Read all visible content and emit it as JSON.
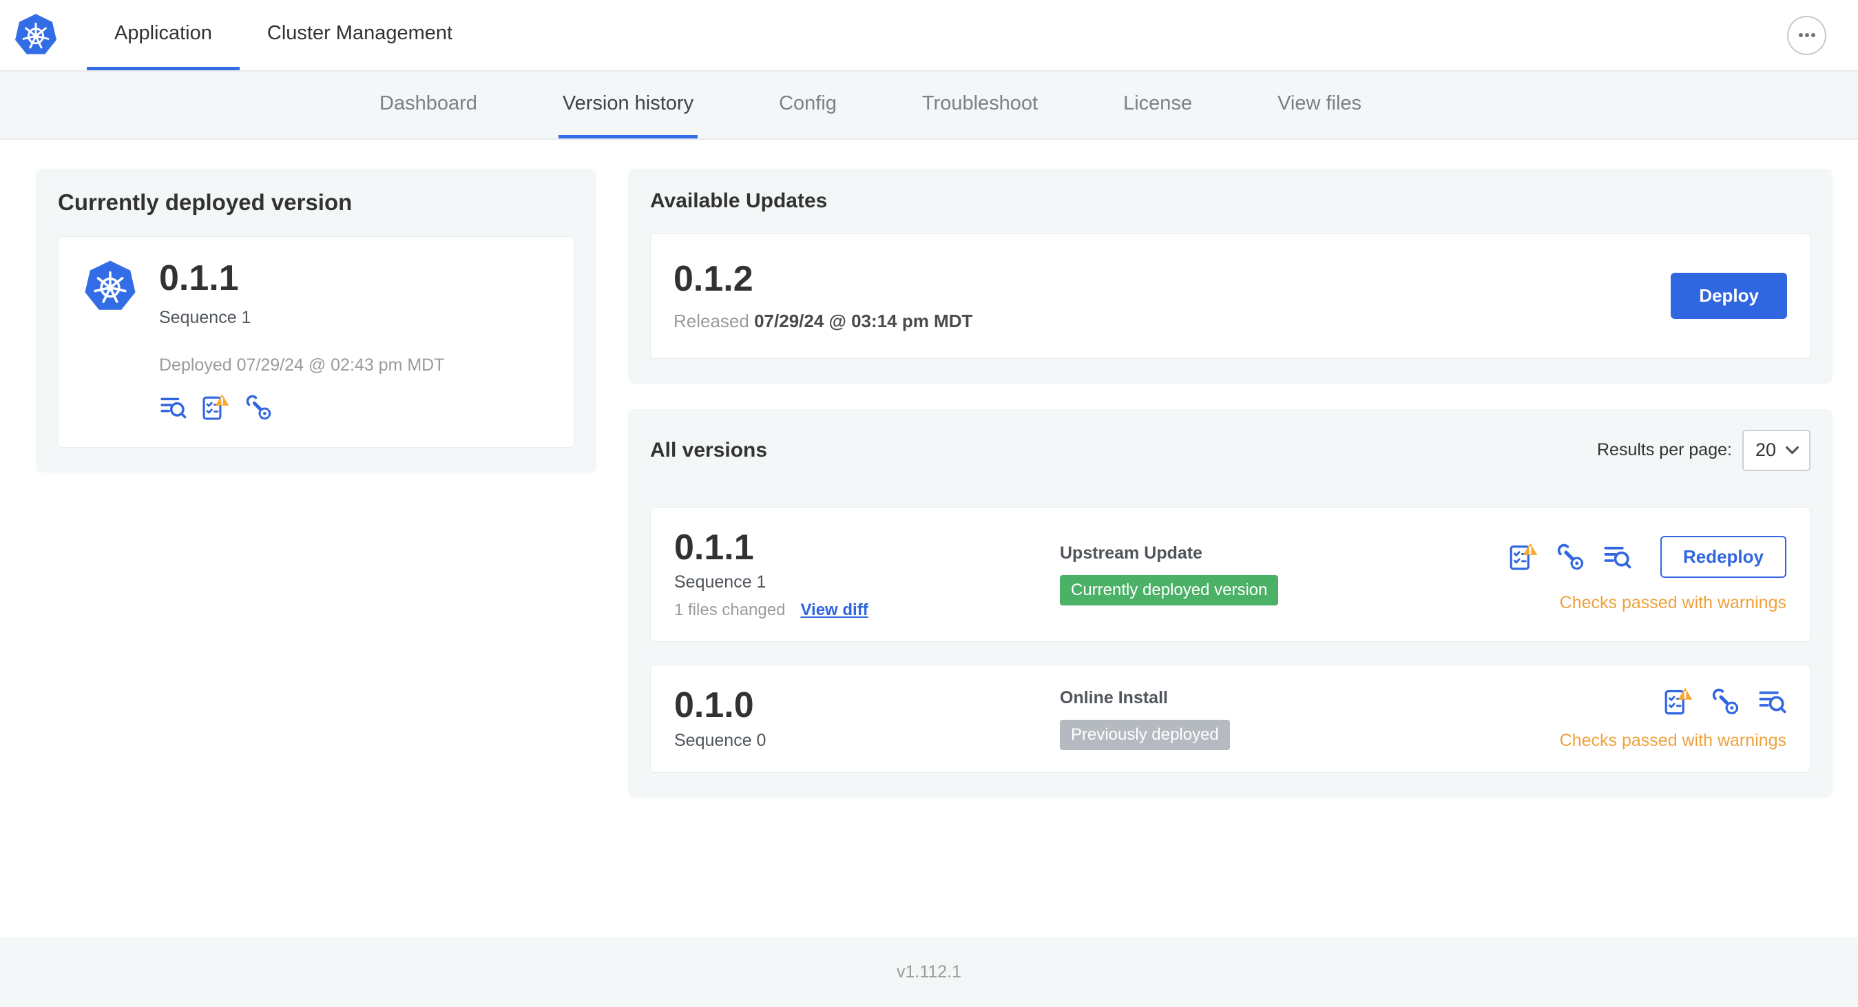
{
  "topnav": {
    "tabs": [
      "Application",
      "Cluster Management"
    ],
    "active": "Application",
    "more_icon": "ellipsis-icon"
  },
  "subnav": {
    "tabs": [
      "Dashboard",
      "Version history",
      "Config",
      "Troubleshoot",
      "License",
      "View files"
    ],
    "active": "Version history"
  },
  "deployed": {
    "title": "Currently deployed version",
    "version": "0.1.1",
    "sequence": "Sequence 1",
    "deployed_at": "Deployed 07/29/24 @ 02:43 pm MDT",
    "icons": [
      "deploy-logs-icon",
      "preflight-checks-warning-icon",
      "edit-config-icon"
    ]
  },
  "available_updates": {
    "title": "Available Updates",
    "version": "0.1.2",
    "released_label": "Released",
    "released_date": "07/29/24 @ 03:14 pm MDT",
    "deploy_button": "Deploy"
  },
  "all_versions": {
    "title": "All versions",
    "results_per_page_label": "Results per page:",
    "results_per_page": "20",
    "rows": [
      {
        "version": "0.1.1",
        "sequence": "Sequence 1",
        "files_changed": "1 files changed",
        "view_diff_link": "View diff",
        "source": "Upstream Update",
        "badge": "Currently deployed version",
        "badge_color": "#4bb166",
        "icons": [
          "preflight-checks-warning-icon",
          "edit-config-icon",
          "deploy-logs-icon"
        ],
        "action_button": "Redeploy",
        "status": "Checks passed with warnings",
        "status_color": "#efa13b"
      },
      {
        "version": "0.1.0",
        "sequence": "Sequence 0",
        "source": "Online Install",
        "badge": "Previously deployed",
        "badge_color": "#b5bac1",
        "icons": [
          "preflight-checks-warning-icon",
          "edit-config-icon",
          "deploy-logs-icon"
        ],
        "status": "Checks passed with warnings",
        "status_color": "#efa13b"
      }
    ]
  },
  "footer": {
    "app_version": "v1.112.1"
  },
  "colors": {
    "accent_blue": "#3066e0",
    "kubernetes_blue": "#326de6",
    "warning_orange": "#efa13b",
    "warning_triangle": "#f7a733",
    "badge_green": "#4bb166",
    "badge_gray": "#b5bac1",
    "panel_bg": "#f4f7f8"
  }
}
